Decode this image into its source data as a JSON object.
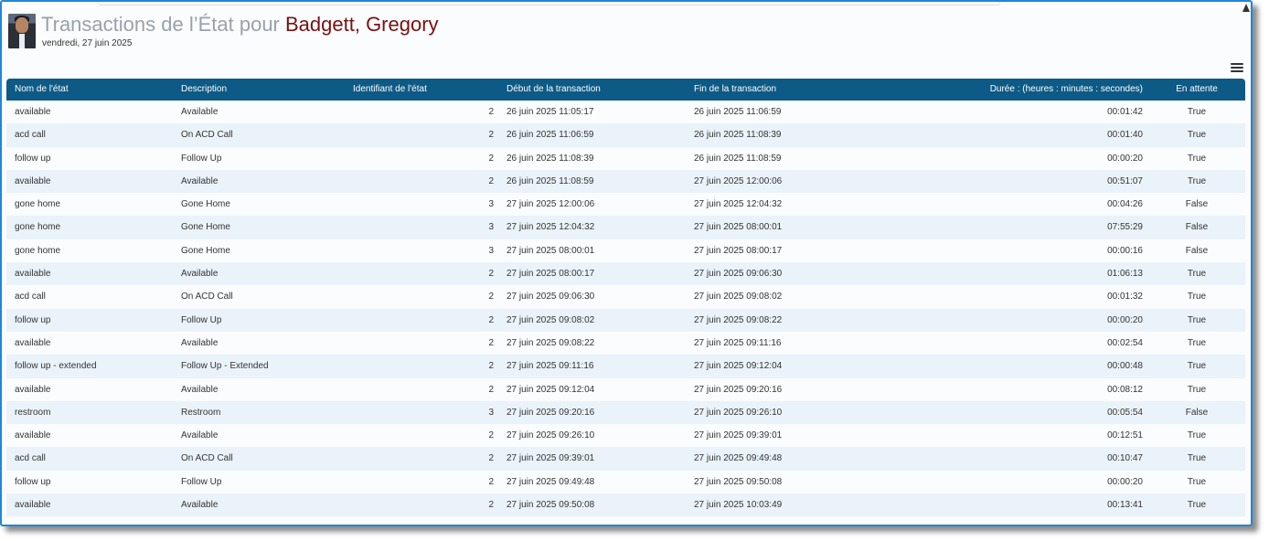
{
  "header": {
    "title_prefix": "Transactions de l’État pour",
    "user_name": "Badgett, Gregory",
    "date": "vendredi, 27 juin 2025"
  },
  "icons": {
    "menu": "hamburger-menu-icon",
    "scroll": "scroll-up-arrow-icon"
  },
  "colors": {
    "header_bg": "#0d5a86",
    "name_color": "#7a1111",
    "frame_border": "#1e88d8",
    "alt_row": "#eaf3fa"
  },
  "table": {
    "columns": [
      "Nom de l'état",
      "Description",
      "Identifiant de l'état",
      "Début de la transaction",
      "Fin de la transaction",
      "Durée : (heures : minutes : secondes)",
      "En attente"
    ],
    "rows": [
      [
        "available",
        "Available",
        "2",
        "26 juin 2025 11:05:17",
        "26 juin 2025 11:06:59",
        "00:01:42",
        "True"
      ],
      [
        "acd call",
        "On ACD Call",
        "2",
        "26 juin 2025 11:06:59",
        "26 juin 2025 11:08:39",
        "00:01:40",
        "True"
      ],
      [
        "follow up",
        "Follow Up",
        "2",
        "26 juin 2025 11:08:39",
        "26 juin 2025 11:08:59",
        "00:00:20",
        "True"
      ],
      [
        "available",
        "Available",
        "2",
        "26 juin 2025 11:08:59",
        "27 juin 2025 12:00:06",
        "00:51:07",
        "True"
      ],
      [
        "gone home",
        "Gone Home",
        "3",
        "27 juin 2025 12:00:06",
        "27 juin 2025 12:04:32",
        "00:04:26",
        "False"
      ],
      [
        "gone home",
        "Gone Home",
        "3",
        "27 juin 2025 12:04:32",
        "27 juin 2025 08:00:01",
        "07:55:29",
        "False"
      ],
      [
        "gone home",
        "Gone Home",
        "3",
        "27 juin 2025 08:00:01",
        "27 juin 2025 08:00:17",
        "00:00:16",
        "False"
      ],
      [
        "available",
        "Available",
        "2",
        "27 juin 2025 08:00:17",
        "27 juin 2025 09:06:30",
        "01:06:13",
        "True"
      ],
      [
        "acd call",
        "On ACD Call",
        "2",
        "27 juin 2025 09:06:30",
        "27 juin 2025 09:08:02",
        "00:01:32",
        "True"
      ],
      [
        "follow up",
        "Follow Up",
        "2",
        "27 juin 2025 09:08:02",
        "27 juin 2025 09:08:22",
        "00:00:20",
        "True"
      ],
      [
        "available",
        "Available",
        "2",
        "27 juin 2025 09:08:22",
        "27 juin 2025 09:11:16",
        "00:02:54",
        "True"
      ],
      [
        "follow up - extended",
        "Follow Up - Extended",
        "2",
        "27 juin 2025 09:11:16",
        "27 juin 2025 09:12:04",
        "00:00:48",
        "True"
      ],
      [
        "available",
        "Available",
        "2",
        "27 juin 2025 09:12:04",
        "27 juin 2025 09:20:16",
        "00:08:12",
        "True"
      ],
      [
        "restroom",
        "Restroom",
        "3",
        "27 juin 2025 09:20:16",
        "27 juin 2025 09:26:10",
        "00:05:54",
        "False"
      ],
      [
        "available",
        "Available",
        "2",
        "27 juin 2025 09:26:10",
        "27 juin 2025 09:39:01",
        "00:12:51",
        "True"
      ],
      [
        "acd call",
        "On ACD Call",
        "2",
        "27 juin 2025 09:39:01",
        "27 juin 2025 09:49:48",
        "00:10:47",
        "True"
      ],
      [
        "follow up",
        "Follow Up",
        "2",
        "27 juin 2025 09:49:48",
        "27 juin 2025 09:50:08",
        "00:00:20",
        "True"
      ],
      [
        "available",
        "Available",
        "2",
        "27 juin 2025 09:50:08",
        "27 juin 2025 10:03:49",
        "00:13:41",
        "True"
      ]
    ]
  }
}
